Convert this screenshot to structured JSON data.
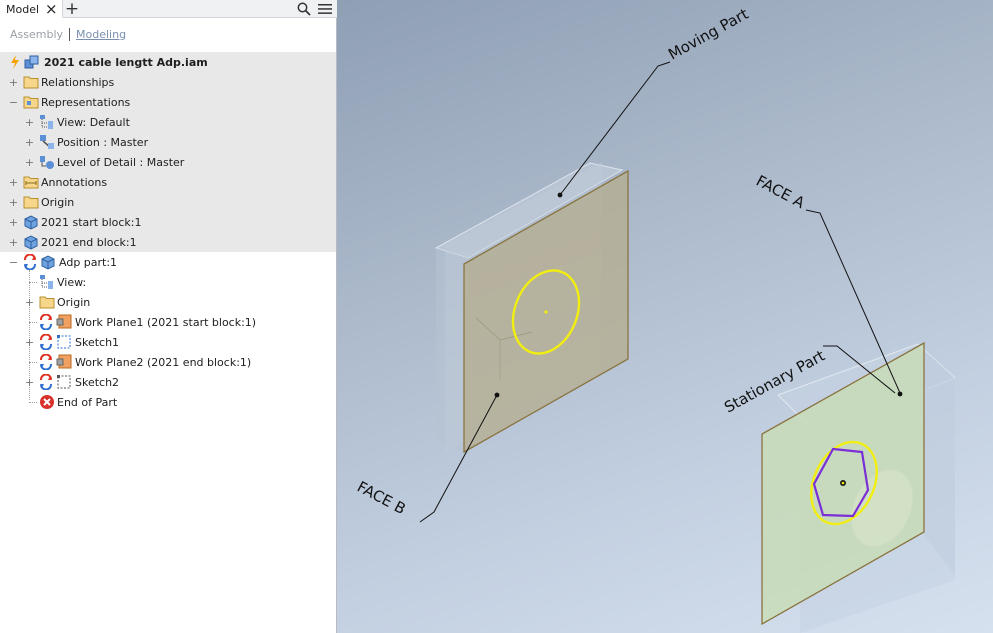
{
  "panel": {
    "tab_label": "Model",
    "close_glyph": "×",
    "add_glyph": "+",
    "search_icon": "search-icon",
    "menu_icon": "hamburger-menu-icon"
  },
  "modes": {
    "assembly": "Assembly",
    "modeling": "Modeling",
    "active": "Modeling"
  },
  "tree": {
    "root": "2021 cable lengtt Adp.iam",
    "relationships": "Relationships",
    "representations": "Representations",
    "view_default": "View: Default",
    "position_master": "Position : Master",
    "lod_master": "Level of Detail : Master",
    "annotations": "Annotations",
    "origin": "Origin",
    "start_block": "2021 start block:1",
    "end_block": "2021 end block:1",
    "adp_part": "Adp part:1",
    "view": "View:",
    "adp_origin": "Origin",
    "work_plane1": "Work Plane1 (2021 start block:1)",
    "sketch1": "Sketch1",
    "work_plane2": "Work Plane2 (2021 end block:1)",
    "sketch2": "Sketch2",
    "end_of_part": "End of Part"
  },
  "viewport": {
    "annotations": {
      "moving_part": "Moving Part",
      "face_a": "FACE A",
      "stationary_part": "Stationary Part",
      "face_b": "FACE B"
    },
    "colors": {
      "background_top": "#8f9fb4",
      "background_bottom": "#d6e1ef",
      "moving_face": "#b5ad90",
      "stationary_face": "#c8dcb6",
      "sketch_circle": "#f2ee10",
      "sketch_hexagon": "#7a2ed6"
    }
  }
}
